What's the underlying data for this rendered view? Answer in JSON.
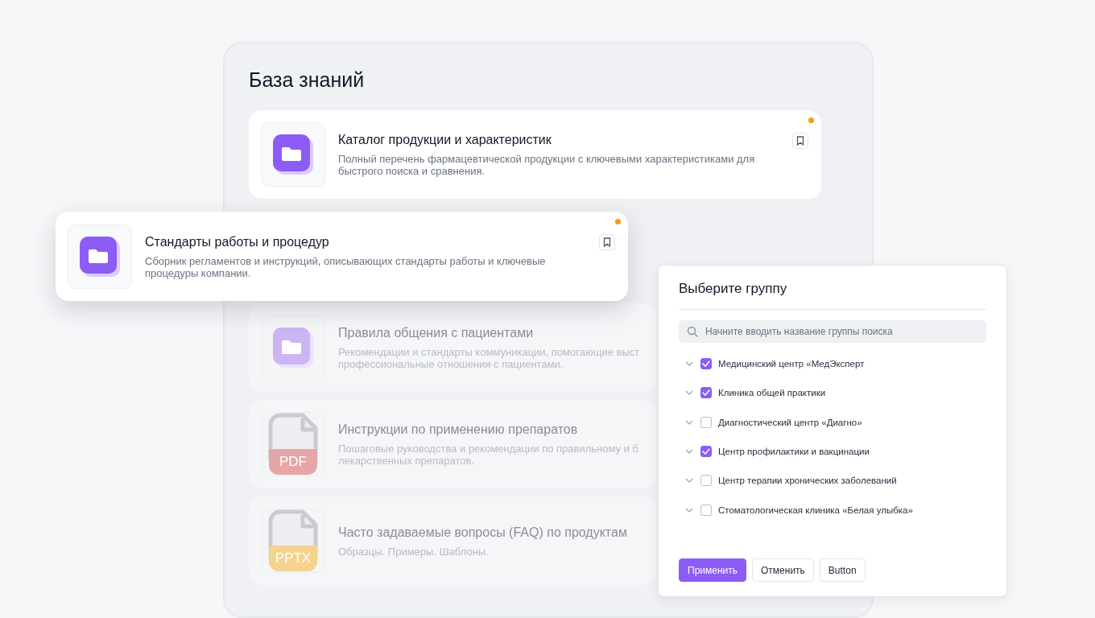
{
  "title": "База знаний",
  "cards": [
    {
      "title": "Каталог продукции и характеристик",
      "description": "Полный перечень фармацевтической продукции с ключевыми характеристиками для\nбыстрого поиска и сравнения.",
      "kind": "folder",
      "faded": false,
      "floating": false,
      "marked": true
    },
    {
      "title": "Стандарты работы и процедур",
      "description": "Сборник регламентов и инструкций, описывающих стандарты работы и ключевые\nпроцедуры компании.",
      "kind": "folder",
      "faded": false,
      "floating": true,
      "marked": true
    },
    {
      "title": "Правила общения с пациентами",
      "description": "Рекомендации и стандарты коммуникации, помогающие выст\nпрофессиональные отношения с пациентами.",
      "kind": "folder",
      "faded": true,
      "floating": false,
      "marked": false
    },
    {
      "title": "Инструкции по применению препаратов",
      "description": "Пошаговые руководства и рекомендации по правильному и б\nлекарственных препаратов.",
      "kind": "file",
      "file_label": "PDF",
      "color": "#e4a6a6",
      "faded": true,
      "floating": false,
      "marked": false
    },
    {
      "title": "Часто задаваемые вопросы (FAQ) по продуктам",
      "description": "Образцы. Примеры. Шаблоны.",
      "kind": "file",
      "file_label": "PPTX",
      "color": "#f4d38f",
      "faded": true,
      "floating": false,
      "marked": false
    }
  ],
  "dialog": {
    "title": "Выберите группу",
    "search": {
      "placeholder": "Начните вводить название группы поиска"
    },
    "items": [
      {
        "label": "Медицинский центр «МедЭксперт",
        "checked": true,
        "expanded": false
      },
      {
        "label": "Клиника общей практики",
        "checked": true,
        "expanded": false
      },
      {
        "label": "Диагностический центр «Диагно»",
        "checked": false,
        "expanded": false
      },
      {
        "label": "Центр профилактики и вакцинации",
        "checked": true,
        "expanded": false
      },
      {
        "label": "Центр терапии хронических заболеваний",
        "checked": false,
        "expanded": false
      },
      {
        "label": "Стоматологическая клиника «Белая улыбка»",
        "checked": false,
        "expanded": false
      }
    ],
    "buttons": [
      {
        "label": "Применить",
        "kind": "primary"
      },
      {
        "label": "Отменить",
        "kind": "secondary"
      },
      {
        "label": "Button",
        "kind": "secondary"
      }
    ]
  }
}
